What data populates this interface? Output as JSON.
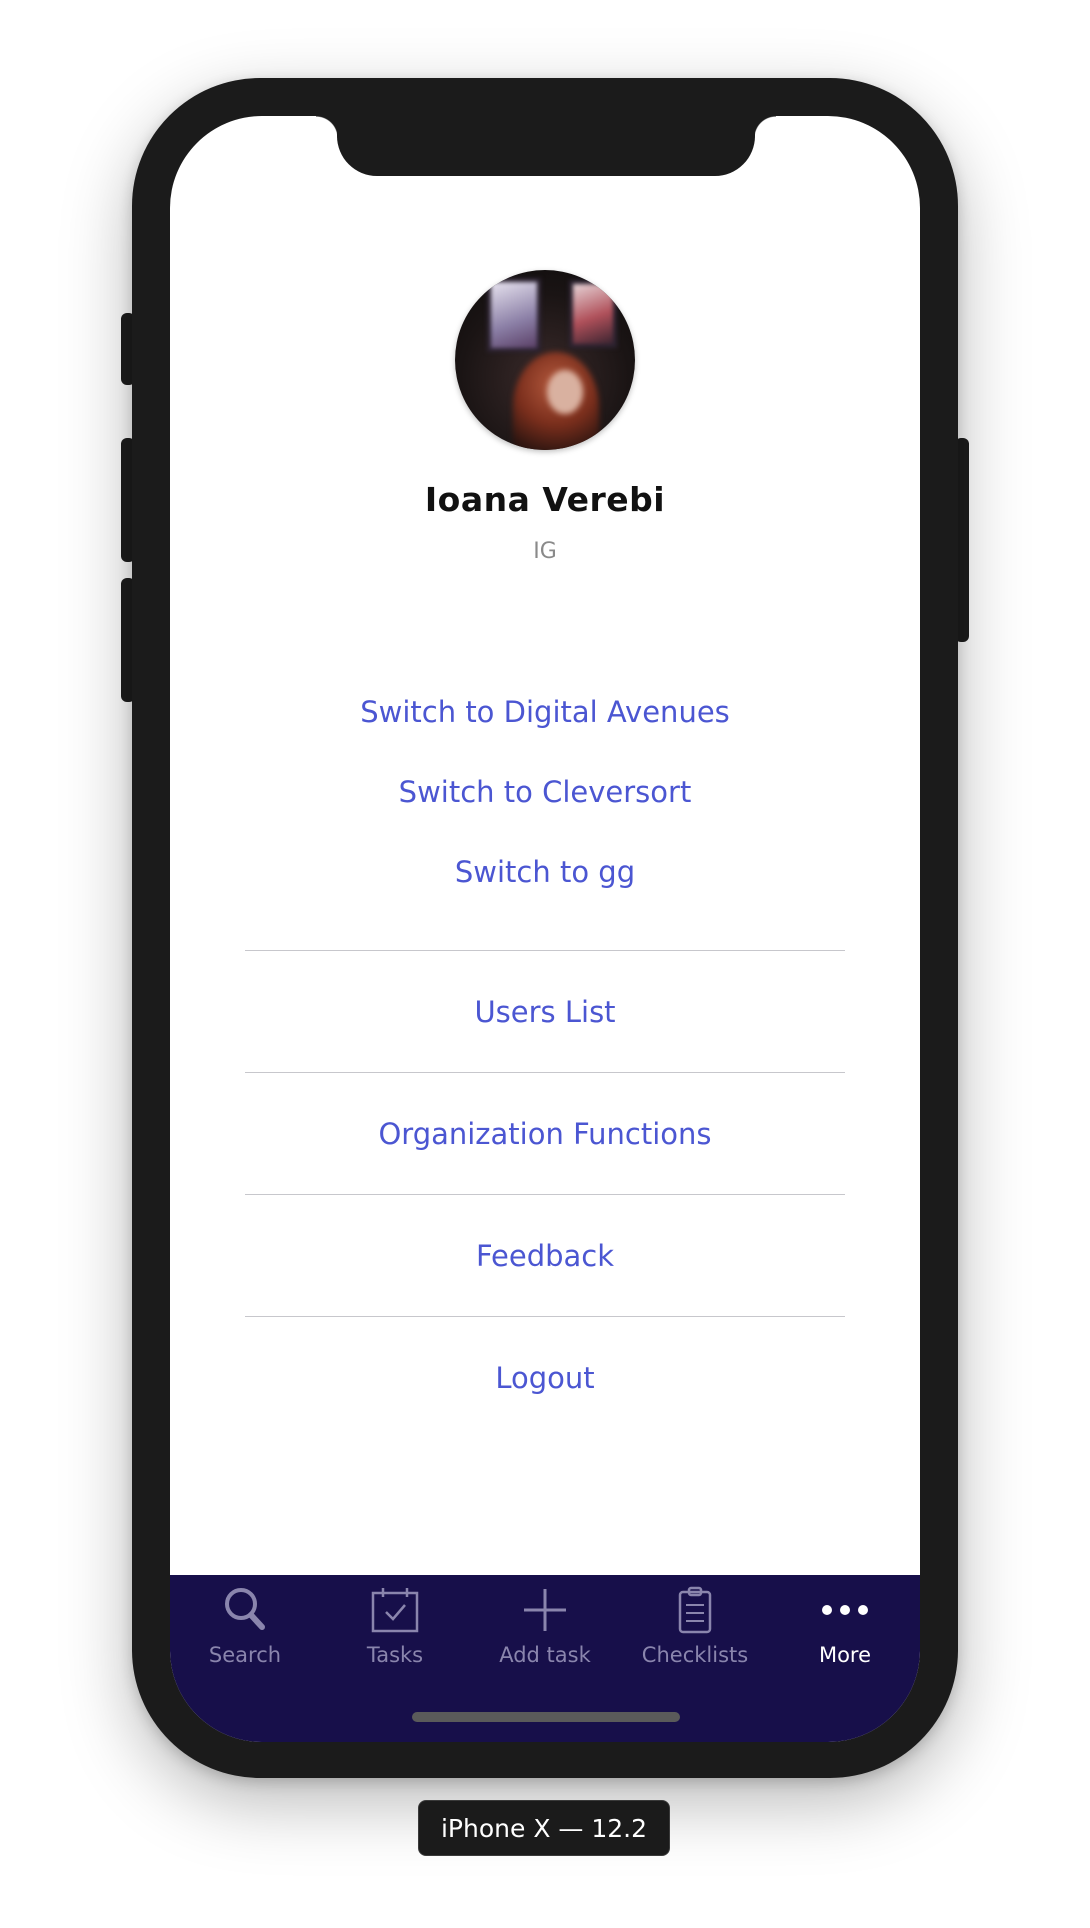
{
  "profile": {
    "name": "Ioana Verebi",
    "initials": "IG"
  },
  "switch_options": [
    "Switch to Digital Avenues",
    "Switch to Cleversort",
    "Switch to gg"
  ],
  "menu": {
    "users_list": "Users List",
    "organization_functions": "Organization Functions",
    "feedback": "Feedback",
    "logout": "Logout"
  },
  "tabbar": {
    "active": "More",
    "tabs": [
      {
        "label": "Search",
        "icon": "search-icon"
      },
      {
        "label": "Tasks",
        "icon": "calendar-check-icon"
      },
      {
        "label": "Add task",
        "icon": "plus-icon"
      },
      {
        "label": "Checklists",
        "icon": "clipboard-icon"
      },
      {
        "label": "More",
        "icon": "more-dots-icon"
      }
    ]
  },
  "device_label": "iPhone X — 12.2",
  "colors": {
    "link": "#4b56d2",
    "tabbar_bg": "#170f4a",
    "tab_inactive": "#8a85ad",
    "tab_active": "#ffffff"
  }
}
